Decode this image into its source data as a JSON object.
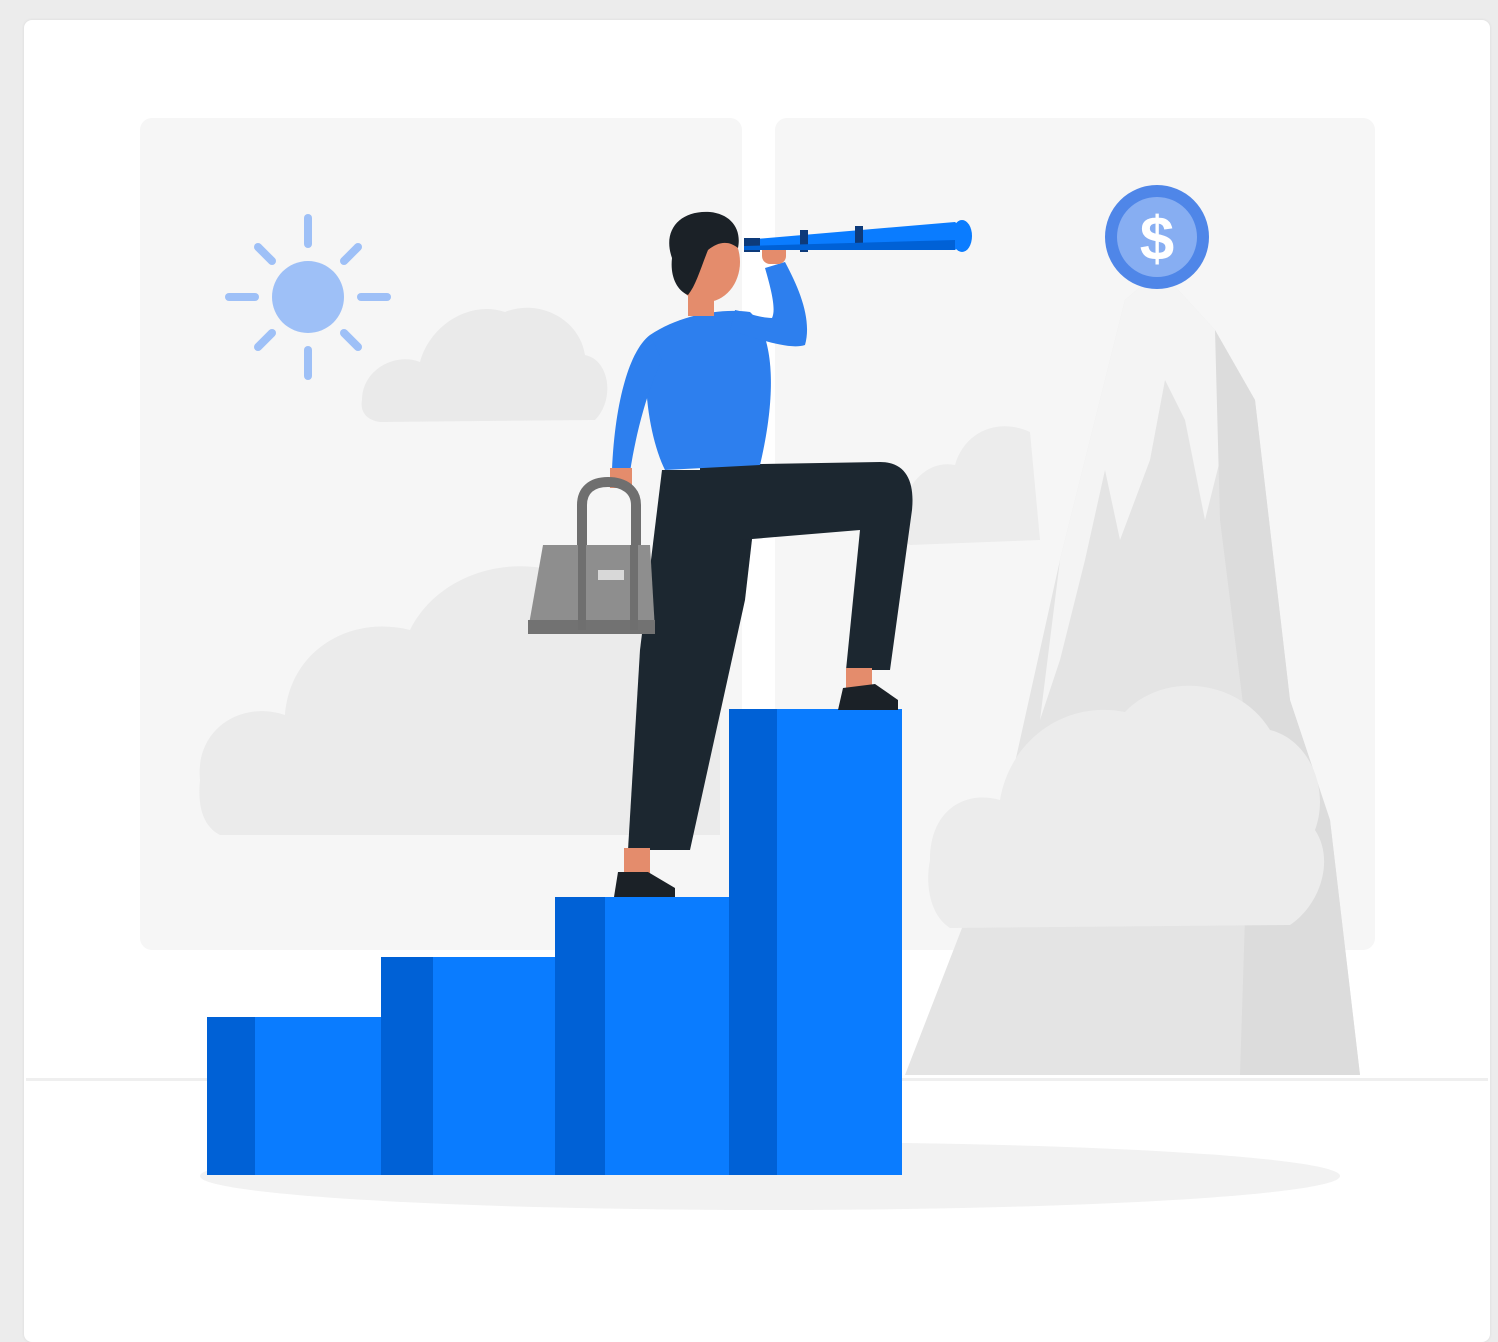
{
  "illustration": {
    "subject": "person-with-telescope-on-growth-stairs",
    "icons": [
      "sun-icon",
      "cloud-icon",
      "mountain-icon",
      "dollar-coin-icon",
      "telescope-icon",
      "handbag-icon"
    ],
    "coin_symbol": "$",
    "colors": {
      "primary_blue": "#0a7cff",
      "dark_blue": "#0061d6",
      "sun_blue": "#9ec0f7",
      "coin_blue": "#4f86e8",
      "trousers": "#1c2730",
      "skin": "#e48c6c",
      "hair": "#1b2127",
      "bag_gray": "#8e8e8e",
      "background_shape": "#f5f5f5",
      "cloud_gray": "#ececec",
      "mountain_gray": "#e6e6e6"
    }
  }
}
